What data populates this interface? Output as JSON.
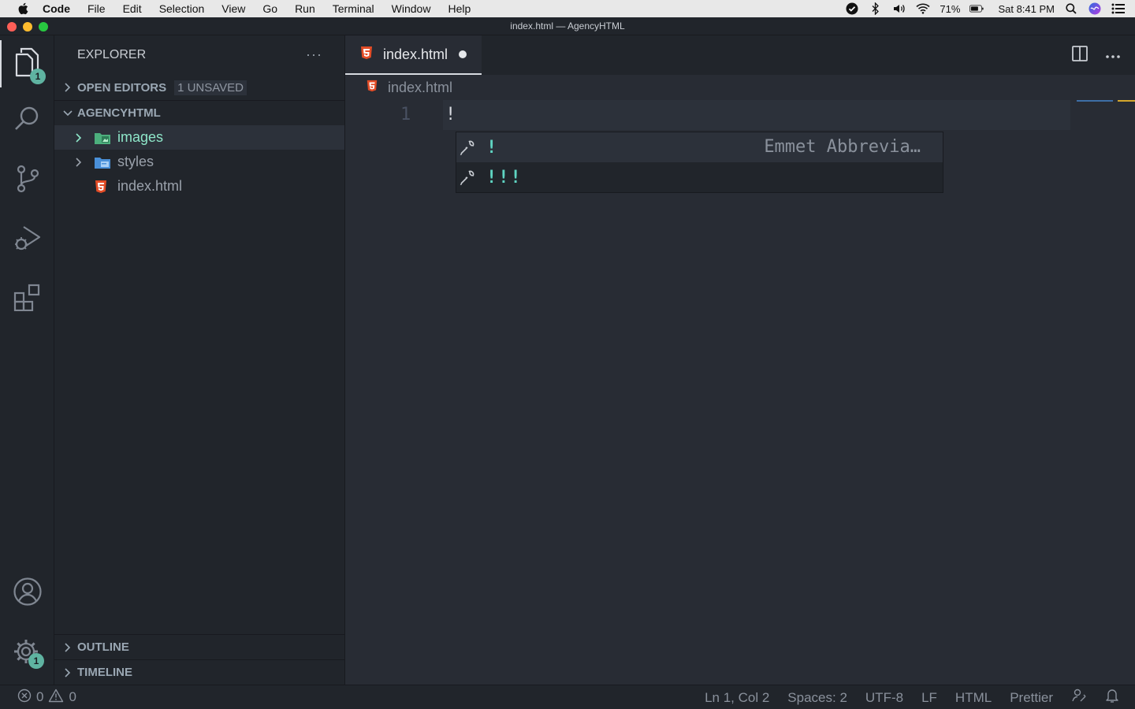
{
  "menubar": {
    "app_name": "Code",
    "items": [
      "File",
      "Edit",
      "Selection",
      "View",
      "Go",
      "Run",
      "Terminal",
      "Window",
      "Help"
    ],
    "battery": "71%",
    "clock": "Sat 8:41 PM"
  },
  "window": {
    "title": "index.html — AgencyHTML"
  },
  "activity": {
    "explorer_badge": "1",
    "settings_badge": "1"
  },
  "sidebar": {
    "title": "EXPLORER",
    "more": "···",
    "open_editors": {
      "label": "OPEN EDITORS",
      "pill": "1 UNSAVED"
    },
    "project": {
      "label": "AGENCYHTML"
    },
    "tree": [
      {
        "name": "images",
        "type": "folder"
      },
      {
        "name": "styles",
        "type": "folder"
      },
      {
        "name": "index.html",
        "type": "file"
      }
    ],
    "outline": "OUTLINE",
    "timeline": "TIMELINE"
  },
  "editor": {
    "tab_label": "index.html",
    "breadcrumb": "index.html",
    "line_number": "1",
    "line_text": "!",
    "suggestions": [
      {
        "label": "!",
        "detail": "Emmet Abbrevia…"
      },
      {
        "label": "!!!",
        "detail": ""
      }
    ]
  },
  "statusbar": {
    "errors": "0",
    "warnings": "0",
    "position": "Ln 1, Col 2",
    "spaces": "Spaces: 2",
    "encoding": "UTF-8",
    "eol": "LF",
    "language": "HTML",
    "formatter": "Prettier"
  },
  "colors": {
    "accent_teal": "#5fb3a1",
    "html_icon": "#e34c26",
    "folder_blue": "#4a90d9",
    "folder_green": "#4caf7d"
  }
}
